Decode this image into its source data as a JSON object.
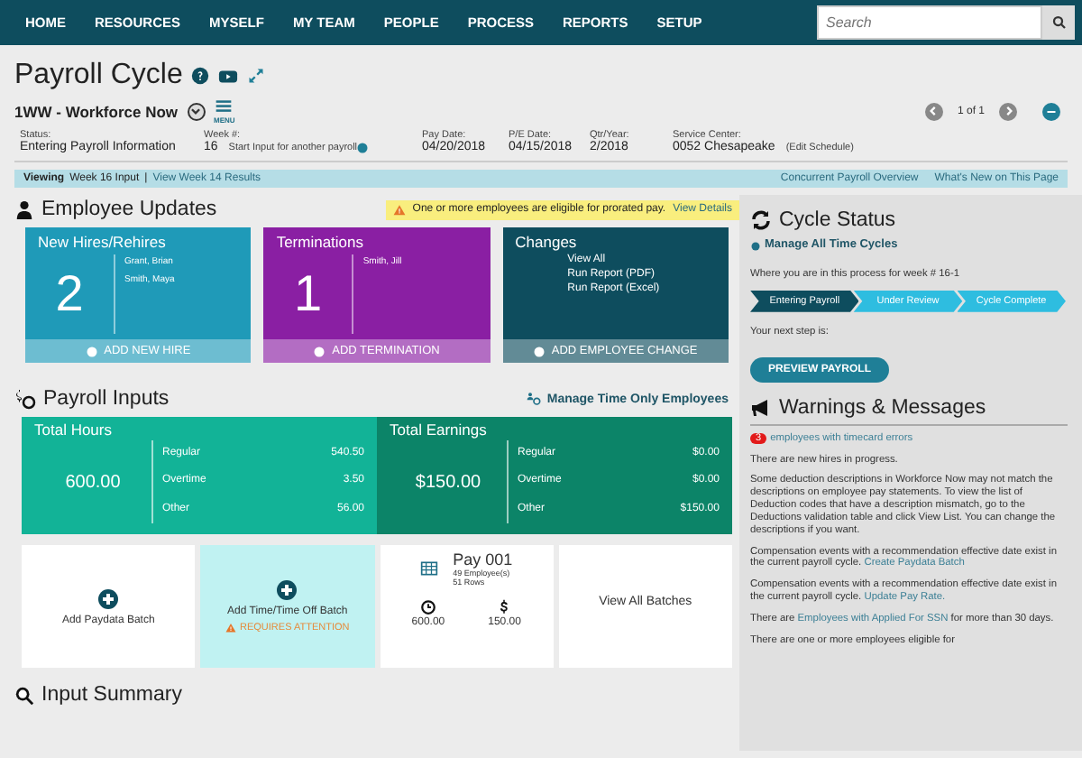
{
  "nav": {
    "items": [
      "HOME",
      "RESOURCES",
      "MYSELF",
      "MY TEAM",
      "PEOPLE",
      "PROCESS",
      "REPORTS",
      "SETUP"
    ],
    "search": {
      "placeholder": "Search"
    }
  },
  "header": {
    "title": "Payroll Cycle",
    "company": "1WW - Workforce Now",
    "menu_label": "MENU",
    "pager": "1 of 1",
    "fields": [
      {
        "label": "Status:",
        "value": "Entering Payroll Information"
      },
      {
        "label": "Week #:",
        "value": "16",
        "note": "Start Input for another payroll"
      },
      {
        "label": "Pay Date:",
        "value": "04/20/2018"
      },
      {
        "label": "P/E Date:",
        "value": "04/15/2018"
      },
      {
        "label": "Qtr/Year:",
        "value": "2/2018"
      },
      {
        "label": "Service Center:",
        "value": "0052  Chesapeake",
        "note": "(Edit Schedule)"
      }
    ]
  },
  "viewing_bar": {
    "label": "Viewing",
    "current": "Week 16 Input",
    "separator": "|",
    "other": "View Week 14 Results",
    "links": [
      "Concurrent Payroll Overview",
      "What's New on This Page"
    ]
  },
  "employee_updates": {
    "title": "Employee Updates",
    "alert": "One or more employees are eligible for prorated pay.",
    "alert_link": "View Details",
    "cards": [
      {
        "kind": "count",
        "title": "New Hires/Rehires",
        "count": "2",
        "names": [
          "Grant, Brian",
          "Smith, Maya"
        ],
        "action": "ADD NEW HIRE",
        "color": "#1f9ab8"
      },
      {
        "kind": "count",
        "title": "Terminations",
        "count": "1",
        "names": [
          "Smith, Jill"
        ],
        "action": "ADD TERMINATION",
        "color": "#8a1fa3"
      },
      {
        "kind": "links",
        "title": "Changes",
        "links": [
          "View All",
          "Run Report (PDF)",
          "Run Report (Excel)"
        ],
        "action": "ADD EMPLOYEE CHANGE",
        "color": "#0e4d5e"
      }
    ]
  },
  "payroll_inputs": {
    "title": "Payroll Inputs",
    "manage_link": "Manage Time Only Employees",
    "totals": [
      {
        "title": "Total Hours",
        "total": "600.00",
        "color": "#12b397",
        "rows": [
          {
            "label": "Regular",
            "value": "540.50"
          },
          {
            "label": "Overtime",
            "value": "3.50"
          },
          {
            "label": "Other",
            "value": "56.00"
          }
        ]
      },
      {
        "title": "Total Earnings",
        "total": "$150.00",
        "color": "#0c8468",
        "rows": [
          {
            "label": "Regular",
            "value": "$0.00"
          },
          {
            "label": "Overtime",
            "value": "$0.00"
          },
          {
            "label": "Other",
            "value": "$150.00"
          }
        ]
      }
    ],
    "batches": [
      {
        "kind": "add",
        "label": "Add Paydata Batch",
        "attention": false
      },
      {
        "kind": "add",
        "label": "Add Time/Time Off Batch",
        "attention": true,
        "attention_label": "REQUIRES ATTENTION"
      },
      {
        "kind": "batch",
        "name": "Pay 001",
        "employees": "49 Employee(s)",
        "rows": "51 Rows",
        "hours": "600.00",
        "amount": "150.00"
      },
      {
        "kind": "link",
        "label": "View All Batches"
      }
    ]
  },
  "input_summary": {
    "title": "Input Summary"
  },
  "cycle_status": {
    "title": "Cycle Status",
    "manage_link": "Manage All Time Cycles",
    "where": "Where you are in this process for week # 16-1",
    "steps": [
      {
        "label": "Entering Payroll",
        "selected": true
      },
      {
        "label": "Under Review",
        "selected": false
      },
      {
        "label": "Cycle Complete",
        "selected": false
      }
    ],
    "next_label": "Your next step is:",
    "next_button": "PREVIEW PAYROLL"
  },
  "warnings": {
    "title": "Warnings & Messages",
    "messages": [
      {
        "kind": "count",
        "count": "3",
        "parts": [
          {
            "kind": "link",
            "text": "employees with timecard errors"
          }
        ]
      },
      {
        "kind": "text",
        "parts": [
          {
            "kind": "text",
            "text": "There are new hires in progress."
          }
        ]
      },
      {
        "kind": "text",
        "parts": [
          {
            "kind": "text",
            "text": "Some deduction descriptions in Workforce Now may not match the descriptions on employee pay statements. To view the list of Deduction codes that have a description mismatch, go to the Deductions validation table and click View List. You can change the descriptions if you want."
          }
        ]
      },
      {
        "kind": "text",
        "parts": [
          {
            "kind": "text",
            "text": "Compensation events with a recommendation effective date exist in the current payroll cycle. "
          },
          {
            "kind": "link",
            "text": "Create Paydata Batch"
          }
        ]
      },
      {
        "kind": "text",
        "parts": [
          {
            "kind": "text",
            "text": "Compensation events with a recommendation effective date exist in the current payroll cycle. "
          },
          {
            "kind": "link",
            "text": "Update Pay Rate."
          }
        ]
      },
      {
        "kind": "text",
        "parts": [
          {
            "kind": "text",
            "text": "There are "
          },
          {
            "kind": "link",
            "text": "Employees with Applied For SSN"
          },
          {
            "kind": "text",
            "text": " for more than 30 days."
          }
        ]
      },
      {
        "kind": "text",
        "parts": [
          {
            "kind": "text",
            "text": "There are one or more employees eligible for"
          }
        ]
      }
    ]
  }
}
